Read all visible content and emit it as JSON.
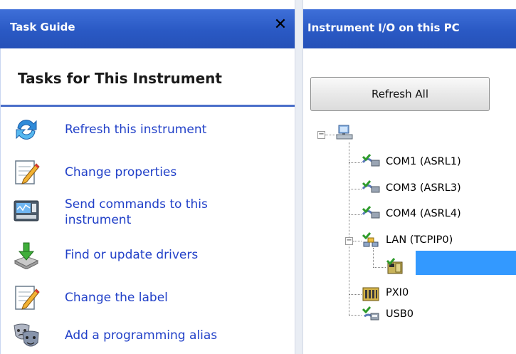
{
  "task_guide": {
    "title": "Task Guide",
    "close_symbol": "✕",
    "section_title": "Tasks for This Instrument",
    "tasks": [
      {
        "label": "Refresh this instrument",
        "icon": "refresh-icon"
      },
      {
        "label": "Change properties",
        "icon": "edit-properties-icon"
      },
      {
        "label": "Send commands to this\ninstrument",
        "icon": "send-commands-icon"
      },
      {
        "label": "Find or update drivers",
        "icon": "download-drivers-icon"
      },
      {
        "label": "Change the label",
        "icon": "edit-label-icon"
      },
      {
        "label": "Add a programming alias",
        "icon": "masks-icon"
      }
    ]
  },
  "instrument_io": {
    "title": "Instrument I/O on this PC",
    "refresh_all_label": "Refresh All",
    "tree": {
      "root_icon": "computer-icon",
      "nodes": [
        {
          "label": "COM1 (ASRL1)",
          "icon": "serial-port-icon"
        },
        {
          "label": "COM3 (ASRL3)",
          "icon": "serial-port-icon"
        },
        {
          "label": "COM4 (ASRL4)",
          "icon": "serial-port-icon"
        },
        {
          "label": "LAN (TCPIP0)",
          "icon": "lan-icon"
        },
        {
          "label": "",
          "icon": "instrument-icon",
          "selected": true
        },
        {
          "label": "PXI0",
          "icon": "pxi-icon"
        },
        {
          "label": "USB0",
          "icon": "usb-icon"
        }
      ]
    }
  },
  "colors": {
    "header_blue": "#2a59c4",
    "link_blue": "#2140c8",
    "selection_blue": "#3399ff"
  }
}
